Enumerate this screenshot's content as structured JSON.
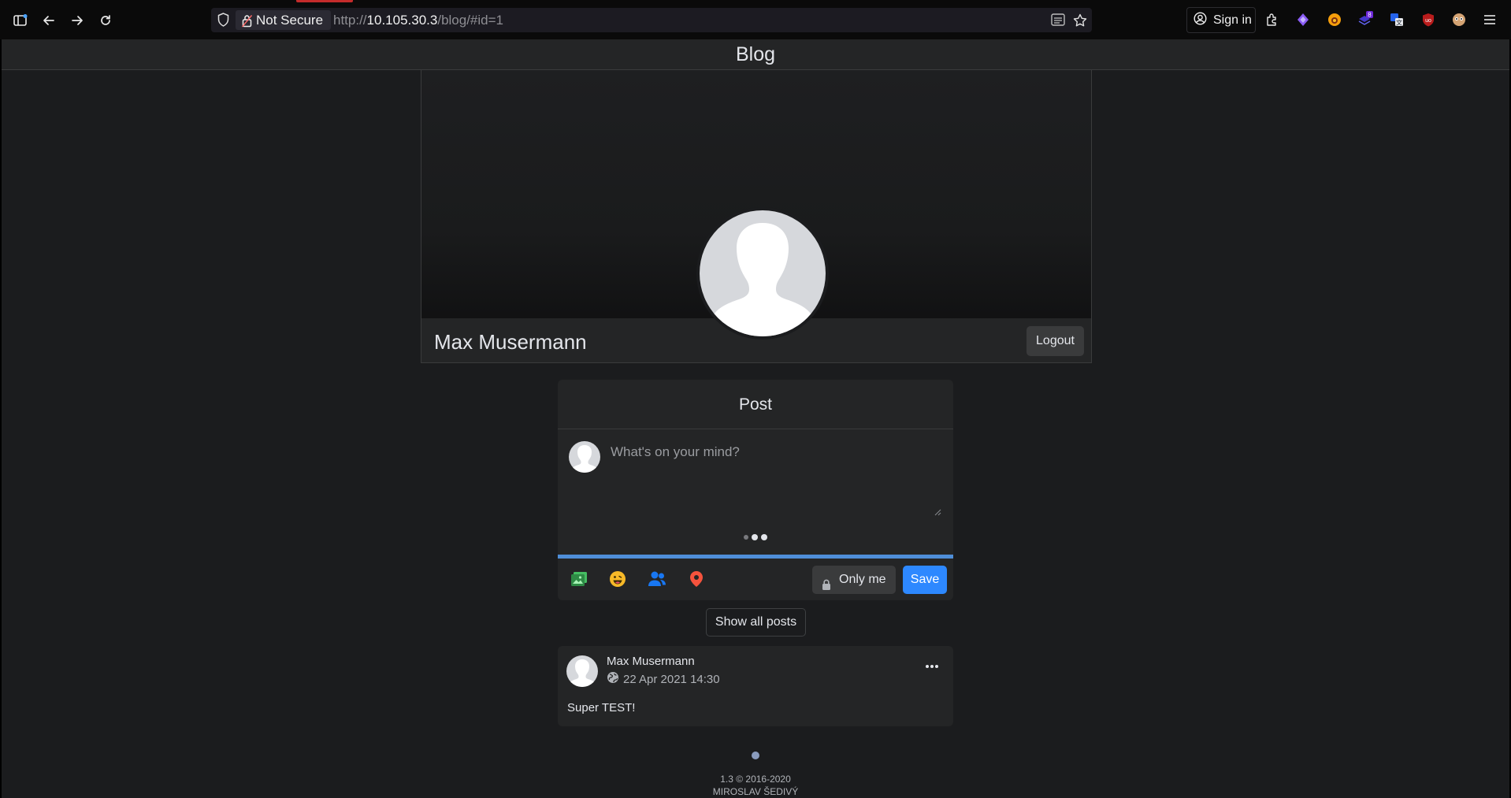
{
  "browser": {
    "security_label": "Not Secure",
    "url_prefix": "http://",
    "url_host": "10.105.30.3",
    "url_path": "/blog/#id=1",
    "signin_label": "Sign in",
    "extension_badge": "8"
  },
  "page": {
    "title": "Blog"
  },
  "profile": {
    "name": "Max Musermann",
    "logout_label": "Logout"
  },
  "composer": {
    "title": "Post",
    "placeholder": "What's on your mind?",
    "privacy_label": "Only me",
    "save_label": "Save",
    "progress_percent": 100,
    "tools": [
      "photo-icon",
      "emoji-icon",
      "tag-people-icon",
      "location-icon"
    ]
  },
  "show_all_label": "Show all posts",
  "posts": [
    {
      "author": "Max Musermann",
      "timestamp": "22 Apr 2021 14:30",
      "visibility_icon": "globe-icon",
      "text": "Super TEST!"
    }
  ],
  "footer": {
    "version": "1.3 © 2016-2020",
    "author": "MIROSLAV ŠEDIVÝ"
  },
  "colors": {
    "accent": "#2d88ff",
    "progress": "#4f8ed8",
    "surface": "#242526",
    "background": "#1b1c1e"
  }
}
